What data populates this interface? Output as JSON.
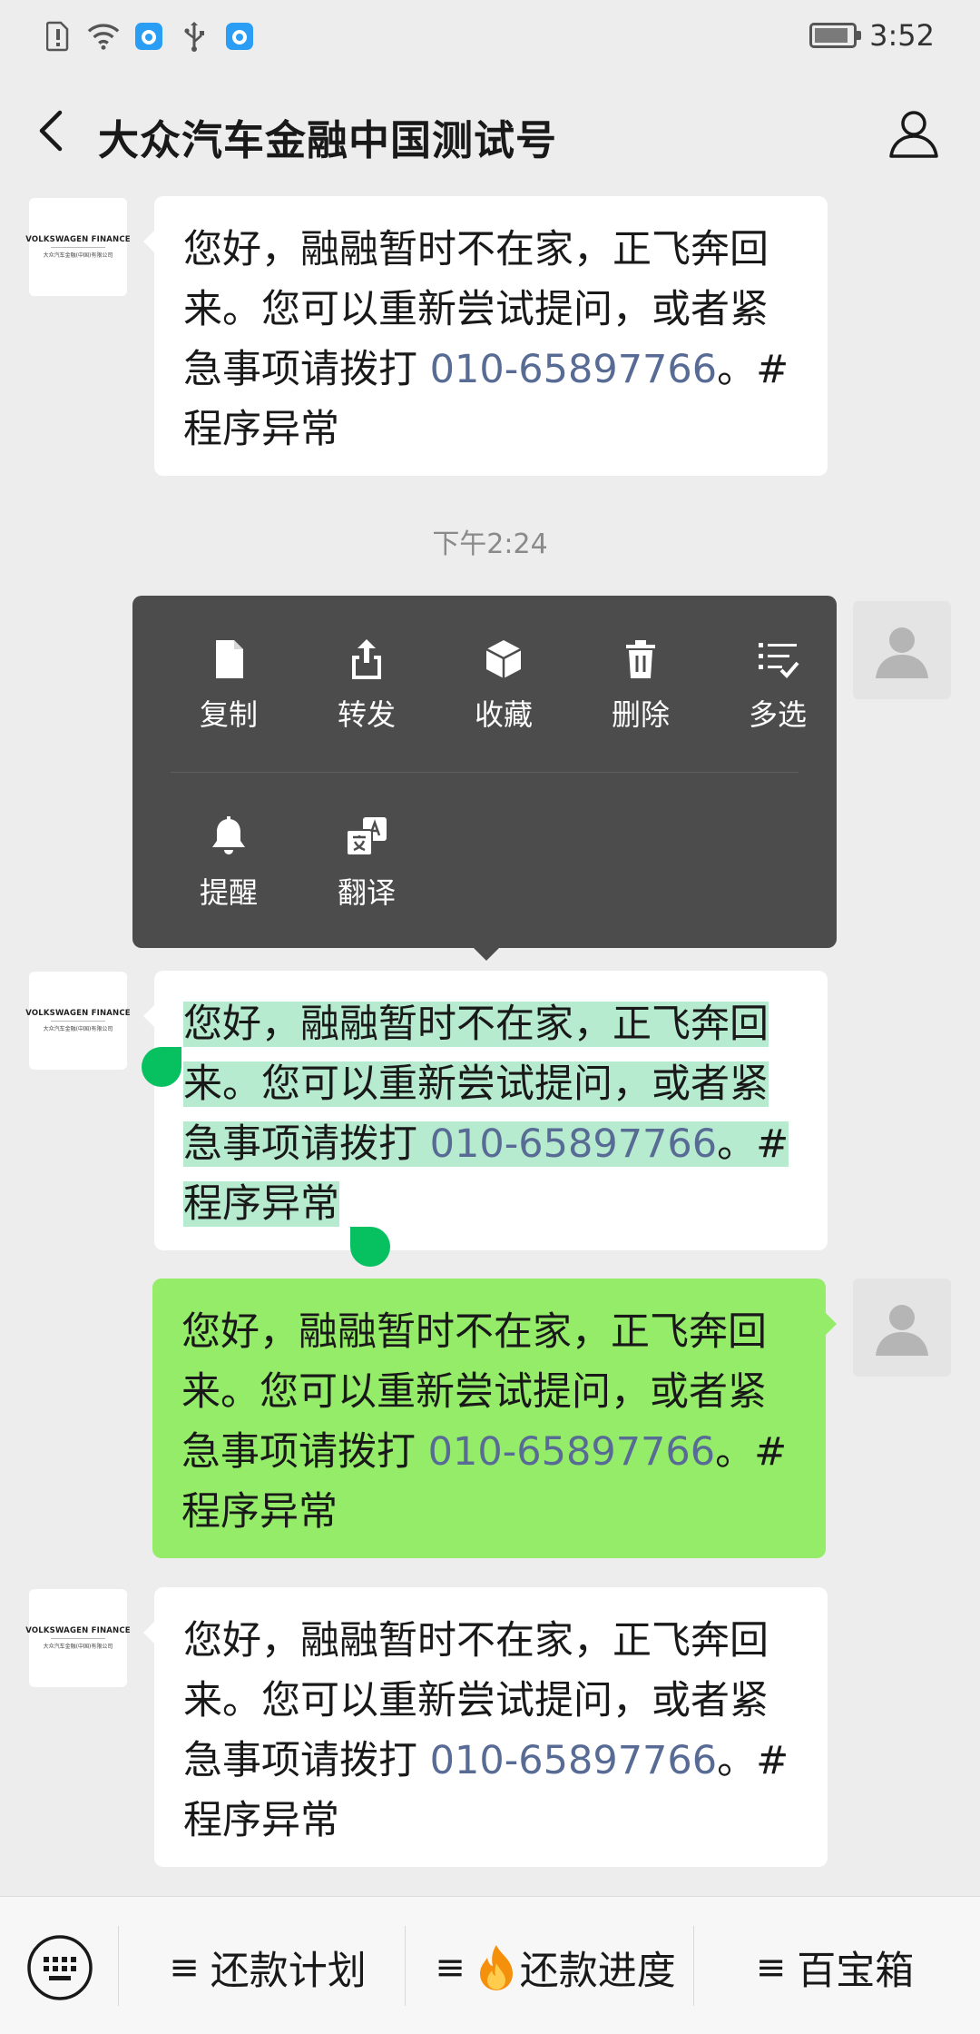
{
  "status_bar": {
    "time": "3:52",
    "left_icons": [
      "alert-icon",
      "wifi-icon",
      "app-notification-icon",
      "usb-icon",
      "app-notification-icon"
    ]
  },
  "header": {
    "title": "大众汽车金融中国测试号"
  },
  "avatar": {
    "brand_line": "VOLKSWAGEN FINANCE",
    "brand_sub": "大众汽车金融(中国)有限公司"
  },
  "messages": [
    {
      "side": "left",
      "text_before": "您好，融融暂时不在家，正飞奔回来。您可以重新尝试提问，或者紧急事项请拨打 ",
      "phone": "010-65897766",
      "text_after": "。#程序异常"
    },
    {
      "side": "left",
      "selected": true,
      "text_before": "您好，融融暂时不在家，正飞奔回来。您可以重新尝试提问，或者紧急事项请拨打 ",
      "phone": "010-65897766",
      "text_after": "。#程序异常"
    },
    {
      "side": "right",
      "text_before": "您好，融融暂时不在家，正飞奔回来。您可以重新尝试提问，或者紧急事项请拨打 ",
      "phone": "010-65897766",
      "text_after": "。#程序异常"
    },
    {
      "side": "left",
      "text_before": "您好，融融暂时不在家，正飞奔回来。您可以重新尝试提问，或者紧急事项请拨打 ",
      "phone": "010-65897766",
      "text_after": "。#程序异常"
    }
  ],
  "timestamp": "下午2:24",
  "context_menu": {
    "items": [
      {
        "label": "复制",
        "icon": "copy-icon"
      },
      {
        "label": "转发",
        "icon": "forward-icon"
      },
      {
        "label": "收藏",
        "icon": "favorite-icon"
      },
      {
        "label": "删除",
        "icon": "delete-icon"
      },
      {
        "label": "多选",
        "icon": "multi-select-icon"
      },
      {
        "label": "提醒",
        "icon": "remind-bell-icon"
      },
      {
        "label": "翻译",
        "icon": "translate-icon"
      }
    ]
  },
  "bottom_menu": {
    "items": [
      {
        "label": "还款计划"
      },
      {
        "label": "还款进度"
      },
      {
        "label": "百宝箱"
      }
    ],
    "menu_glyph": "≡"
  },
  "colors": {
    "background": "#ededed",
    "bubble_left": "#ffffff",
    "bubble_right": "#95ec69",
    "link": "#576b95",
    "selection": "#b7ebd0",
    "selection_handle": "#07c160",
    "menu_bg": "#4c4c4c"
  }
}
